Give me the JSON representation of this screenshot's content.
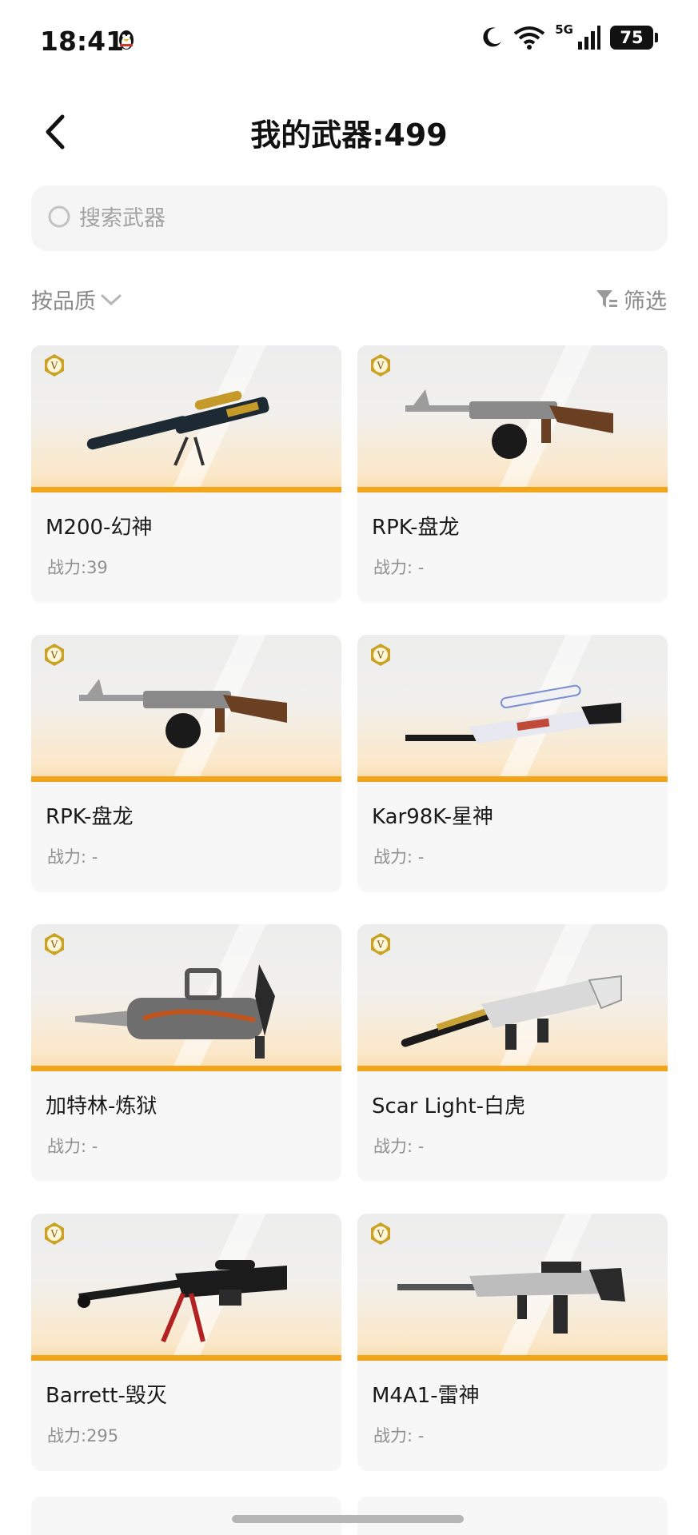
{
  "status_bar": {
    "time": "18:41",
    "network": "5G",
    "battery": "75"
  },
  "header": {
    "back_icon": "chevron-left-icon",
    "title": "我的武器:499"
  },
  "search": {
    "placeholder": "搜索武器",
    "value": ""
  },
  "controls": {
    "sort_label": "按品质",
    "filter_label": "筛选"
  },
  "weapons": [
    {
      "name": "M200-幻神",
      "power": "战力:39",
      "type": "sniper-gold",
      "colors": [
        "#1d2a33",
        "#c59a2a"
      ]
    },
    {
      "name": "RPK-盘龙",
      "power": "战力: -",
      "type": "rpk",
      "colors": [
        "#9c9c9c",
        "#6b3f22"
      ]
    },
    {
      "name": "RPK-盘龙",
      "power": "战力: -",
      "type": "rpk",
      "colors": [
        "#9c9c9c",
        "#6b3f22"
      ]
    },
    {
      "name": "Kar98K-星神",
      "power": "战力: -",
      "type": "kar98",
      "colors": [
        "#e8e8f0",
        "#1b1b1b"
      ]
    },
    {
      "name": "加特林-炼狱",
      "power": "战力: -",
      "type": "gatling",
      "colors": [
        "#6e6e6e",
        "#c2541e"
      ]
    },
    {
      "name": "Scar Light-白虎",
      "power": "战力: -",
      "type": "scar",
      "colors": [
        "#d9d9d9",
        "#c9a235"
      ]
    },
    {
      "name": "Barrett-毁灭",
      "power": "战力:295",
      "type": "barrett",
      "colors": [
        "#1b1b1b",
        "#b22222"
      ]
    },
    {
      "name": "M4A1-雷神",
      "power": "战力: -",
      "type": "m4a1",
      "colors": [
        "#2a2a2a",
        "#bdbdbd"
      ]
    }
  ]
}
